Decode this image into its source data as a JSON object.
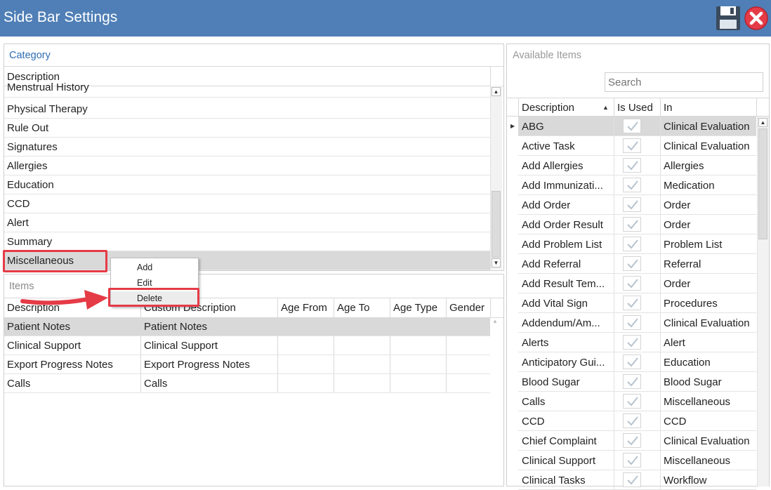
{
  "window": {
    "title": "Side Bar Settings"
  },
  "category": {
    "title": "Category",
    "header": "Description",
    "rows": [
      "Menstrual History",
      "Physical Therapy",
      "Rule Out",
      "Signatures",
      "Allergies",
      "Education",
      "CCD",
      "Alert",
      "Summary",
      "Miscellaneous"
    ],
    "selected": "Miscellaneous"
  },
  "context_menu": {
    "items": [
      "Add",
      "Edit",
      "Delete"
    ]
  },
  "items": {
    "title": "Items",
    "headers": [
      "Description",
      "Custom Description",
      "Age From",
      "Age To",
      "Age Type",
      "Gender"
    ],
    "rows": [
      [
        "Patient Notes",
        "Patient Notes"
      ],
      [
        "Clinical Support",
        "Clinical Support"
      ],
      [
        "Export Progress Notes",
        "Export Progress Notes"
      ],
      [
        "Calls",
        "Calls"
      ]
    ]
  },
  "available": {
    "title": "Available Items",
    "search_placeholder": "Search",
    "headers": [
      "Description",
      "Is Used",
      "In"
    ],
    "rows": [
      [
        "ABG",
        "Clinical Evaluation"
      ],
      [
        "Active Task",
        "Clinical Evaluation"
      ],
      [
        "Add Allergies",
        "Allergies"
      ],
      [
        "Add Immunizati...",
        "Medication"
      ],
      [
        "Add Order",
        "Order"
      ],
      [
        "Add Order Result",
        "Order"
      ],
      [
        "Add Problem List",
        "Problem List"
      ],
      [
        "Add Referral",
        "Referral"
      ],
      [
        "Add Result Tem...",
        "Order"
      ],
      [
        "Add Vital Sign",
        "Procedures"
      ],
      [
        "Addendum/Am...",
        "Clinical Evaluation"
      ],
      [
        "Alerts",
        "Alert"
      ],
      [
        "Anticipatory Gui...",
        "Education"
      ],
      [
        "Blood Sugar",
        "Blood Sugar"
      ],
      [
        "Calls",
        "Miscellaneous"
      ],
      [
        "CCD",
        "CCD"
      ],
      [
        "Chief Complaint",
        "Clinical Evaluation"
      ],
      [
        "Clinical Support",
        "Miscellaneous"
      ],
      [
        "Clinical Tasks",
        "Workflow"
      ]
    ]
  },
  "colors": {
    "titlebar": "#4f7fb6",
    "highlight": "#e53b47",
    "link": "#2e6db4"
  }
}
